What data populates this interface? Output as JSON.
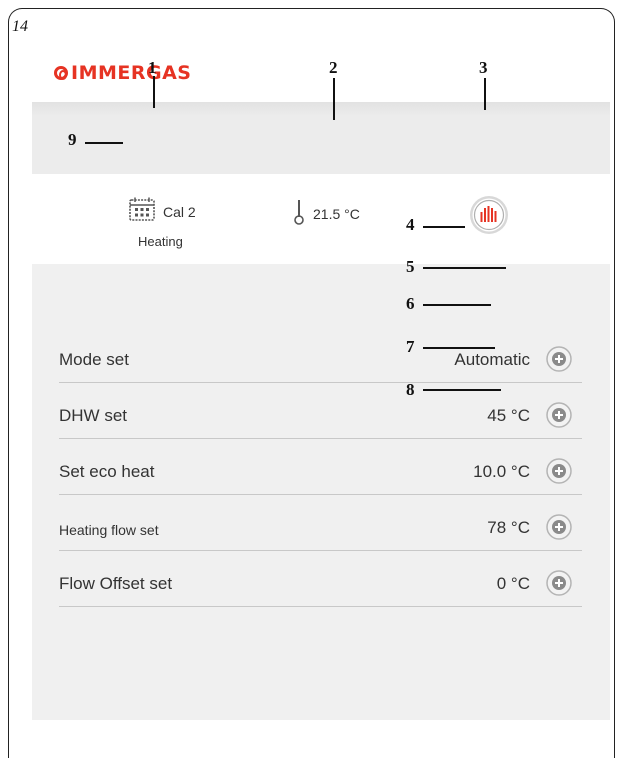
{
  "page_number": "14",
  "logo": {
    "text": "IMMERGAS"
  },
  "callouts": [
    "1",
    "2",
    "3",
    "4",
    "5",
    "6",
    "7",
    "8",
    "9"
  ],
  "status": {
    "calendar_label": "Cal 2",
    "mode_label": "Heating",
    "temperature": "21.5 °C",
    "calendar_icon": "calendar-icon",
    "temperature_icon": "thermometer-icon",
    "heating_icon": "heating-radiator-icon"
  },
  "settings": [
    {
      "label": "Mode set",
      "value": "Automatic"
    },
    {
      "label": "DHW set",
      "value": "45 °C"
    },
    {
      "label": "Set eco heat",
      "value": "10.0 °C"
    },
    {
      "label": "Heating flow set",
      "value": "78 °C"
    },
    {
      "label": "Flow Offset set",
      "value": "0 °C"
    }
  ],
  "colors": {
    "brand": "#e63323",
    "row_divider": "#c8c8c8",
    "screen_bg": "#f0f0f0"
  }
}
